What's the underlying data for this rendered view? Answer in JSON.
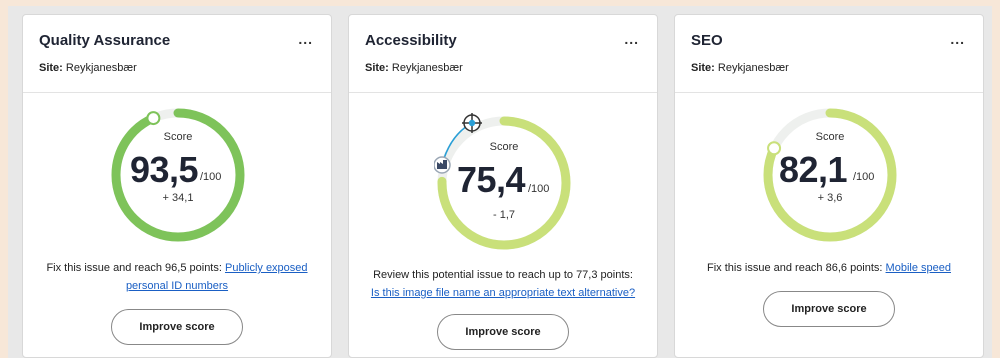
{
  "cards": [
    {
      "title": "Quality Assurance",
      "menu": "...",
      "site_label": "Site:",
      "site_name": "Reykjanesbær",
      "score_label": "Score",
      "score": "93,5",
      "max": "/100",
      "delta": "+ 34,1",
      "score_value": 93.5,
      "arc_color": "#7ec35a",
      "fix_prefix": "Fix this issue and reach 96,5 points: ",
      "fix_link_line1": "Publicly exposed",
      "fix_link_line2": "personal ID numbers",
      "button": "Improve score"
    },
    {
      "title": "Accessibility",
      "menu": "...",
      "site_label": "Site:",
      "site_name": "Reykjanesbær",
      "score_label": "Score",
      "score": "75,4",
      "max": "/100",
      "delta": "- 1,7",
      "score_value": 75.4,
      "arc_color": "#c9e07a",
      "fix_prefix": "Review this potential issue to reach up to 77,3 points:",
      "fix_link": "Is this image file name an appropriate text alternative?",
      "button": "Improve score"
    },
    {
      "title": "SEO",
      "menu": "...",
      "site_label": "Site:",
      "site_name": "Reykjanesbær",
      "score_label": "Score",
      "score": "82,1",
      "max": "/100",
      "delta": "+ 3,6",
      "score_value": 82.1,
      "arc_color": "#c9e07a",
      "fix_prefix": "Fix this issue and reach 86,6 points: ",
      "fix_link": "Mobile speed",
      "button": "Improve score"
    }
  ],
  "colors": {
    "track": "#eef0ee",
    "link": "#1a5fc4",
    "target_line": "#2a9fd6"
  },
  "icons": {
    "target": "crosshair-target-icon",
    "industry": "factory-icon"
  }
}
